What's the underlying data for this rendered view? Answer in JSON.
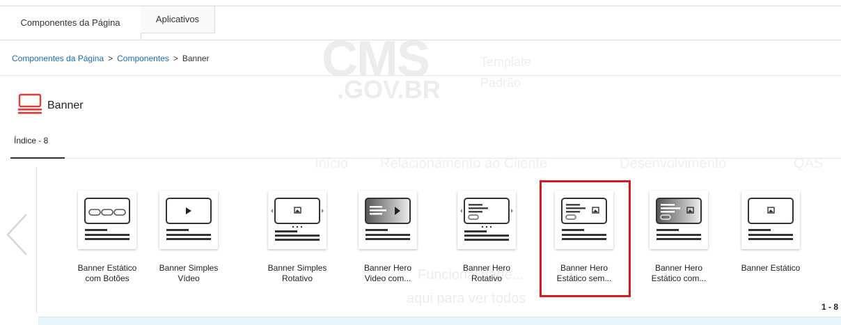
{
  "tabs": [
    {
      "label": "Componentes da Página",
      "active": true
    },
    {
      "label": "Aplicativos",
      "active": false
    }
  ],
  "breadcrumb": {
    "items": [
      "Componentes da Página",
      "Componentes",
      "Banner"
    ],
    "separator": ">"
  },
  "page": {
    "title": "Banner",
    "title_icon": "banner-monitor-icon",
    "accent_color": "#e53935"
  },
  "index_tab": {
    "label": "Índice - 8"
  },
  "cards": [
    {
      "label_line1": "Banner Estático",
      "label_line2": "com Botões",
      "icon": "banner-static-buttons-icon",
      "selected": false
    },
    {
      "label_line1": "Banner Simples",
      "label_line2": "Vídeo",
      "icon": "banner-simple-video-icon",
      "selected": false
    },
    {
      "label_line1": "Banner Simples",
      "label_line2": "Rotativo",
      "icon": "banner-simple-rotating-icon",
      "selected": false
    },
    {
      "label_line1": "Banner Hero",
      "label_line2": "Video com...",
      "icon": "banner-hero-video-icon",
      "selected": false
    },
    {
      "label_line1": "Banner Hero",
      "label_line2": "Rotativo",
      "icon": "banner-hero-rotating-icon",
      "selected": false
    },
    {
      "label_line1": "Banner Hero",
      "label_line2": "Estático sem...",
      "icon": "banner-hero-static-without-icon",
      "selected": true
    },
    {
      "label_line1": "Banner Hero",
      "label_line2": "Estático com...",
      "icon": "banner-hero-static-with-icon",
      "selected": false
    },
    {
      "label_line1": "Banner Estático",
      "label_line2": "",
      "icon": "banner-static-icon",
      "selected": false
    }
  ],
  "highlight_color": "#d71b1b",
  "pagination": {
    "text": "1 - 8"
  },
  "watermark": {
    "logo_line1": "CMS",
    "logo_line2": ".GOV.BR",
    "template_line1": "Template",
    "template_line2": "Padrão",
    "menu": [
      "Início",
      "Relacionamento ao Cliente",
      "Desenvolvimento",
      "QAS"
    ],
    "note_line1": "Funcionalidade...",
    "note_line2": "aqui para ver todos"
  }
}
